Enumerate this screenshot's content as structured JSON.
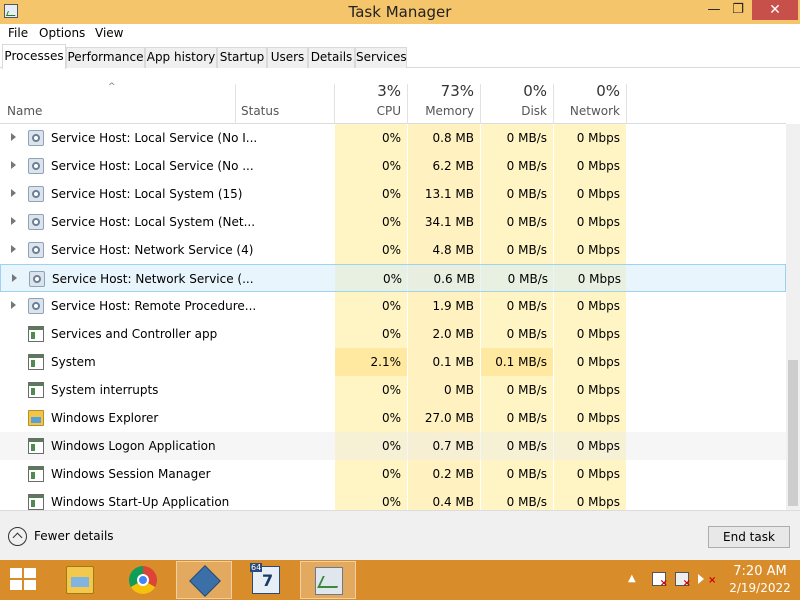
{
  "window": {
    "title": "Task Manager",
    "min_glyph": "—",
    "max_glyph": "❐",
    "close_glyph": "✕"
  },
  "menu": [
    "File",
    "Options",
    "View"
  ],
  "tabs": [
    {
      "label": "Processes",
      "active": true
    },
    {
      "label": "Performance"
    },
    {
      "label": "App history"
    },
    {
      "label": "Startup"
    },
    {
      "label": "Users"
    },
    {
      "label": "Details"
    },
    {
      "label": "Services"
    }
  ],
  "columns": {
    "name": "Name",
    "status": "Status",
    "sort_glyph": "^",
    "cpu": {
      "label": "CPU",
      "value": "3%"
    },
    "memory": {
      "label": "Memory",
      "value": "73%"
    },
    "disk": {
      "label": "Disk",
      "value": "0%"
    },
    "network": {
      "label": "Network",
      "value": "0%"
    }
  },
  "rows": [
    {
      "name": "Service Host: Local Service (No I...",
      "icon": "gear-icon",
      "expandable": true,
      "cpu": "0%",
      "memory": "0.8 MB",
      "disk": "0 MB/s",
      "network": "0 Mbps"
    },
    {
      "name": "Service Host: Local Service (No ...",
      "icon": "gear-icon",
      "expandable": true,
      "cpu": "0%",
      "memory": "6.2 MB",
      "disk": "0 MB/s",
      "network": "0 Mbps"
    },
    {
      "name": "Service Host: Local System (15)",
      "icon": "gear-icon",
      "expandable": true,
      "cpu": "0%",
      "memory": "13.1 MB",
      "disk": "0 MB/s",
      "network": "0 Mbps"
    },
    {
      "name": "Service Host: Local System (Net...",
      "icon": "gear-icon",
      "expandable": true,
      "cpu": "0%",
      "memory": "34.1 MB",
      "disk": "0 MB/s",
      "network": "0 Mbps"
    },
    {
      "name": "Service Host: Network Service (4)",
      "icon": "gear-icon",
      "expandable": true,
      "cpu": "0%",
      "memory": "4.8 MB",
      "disk": "0 MB/s",
      "network": "0 Mbps"
    },
    {
      "name": "Service Host: Network Service (...",
      "icon": "gear-icon",
      "expandable": true,
      "cpu": "0%",
      "memory": "0.6 MB",
      "disk": "0 MB/s",
      "network": "0 Mbps",
      "hovered": true
    },
    {
      "name": "Service Host: Remote Procedure...",
      "icon": "gear-icon",
      "expandable": true,
      "cpu": "0%",
      "memory": "1.9 MB",
      "disk": "0 MB/s",
      "network": "0 Mbps"
    },
    {
      "name": "Services and Controller app",
      "icon": "window-icon",
      "expandable": false,
      "cpu": "0%",
      "memory": "2.0 MB",
      "disk": "0 MB/s",
      "network": "0 Mbps"
    },
    {
      "name": "System",
      "icon": "window-icon",
      "expandable": false,
      "cpu": "2.1%",
      "memory": "0.1 MB",
      "disk": "0.1 MB/s",
      "network": "0 Mbps"
    },
    {
      "name": "System interrupts",
      "icon": "window-icon",
      "expandable": false,
      "cpu": "0%",
      "memory": "0 MB",
      "disk": "0 MB/s",
      "network": "0 Mbps"
    },
    {
      "name": "Windows Explorer",
      "icon": "folder-icon",
      "expandable": false,
      "cpu": "0%",
      "memory": "27.0 MB",
      "disk": "0 MB/s",
      "network": "0 Mbps"
    },
    {
      "name": "Windows Logon Application",
      "icon": "window-icon",
      "expandable": false,
      "cpu": "0%",
      "memory": "0.7 MB",
      "disk": "0 MB/s",
      "network": "0 Mbps",
      "selected": true
    },
    {
      "name": "Windows Session Manager",
      "icon": "window-icon",
      "expandable": false,
      "cpu": "0%",
      "memory": "0.2 MB",
      "disk": "0 MB/s",
      "network": "0 Mbps"
    },
    {
      "name": "Windows Start-Up Application",
      "icon": "window-icon",
      "expandable": false,
      "cpu": "0%",
      "memory": "0.4 MB",
      "disk": "0 MB/s",
      "network": "0 Mbps"
    }
  ],
  "footer": {
    "fewer_details": "Fewer details",
    "end_task": "End task"
  },
  "taskbar": {
    "apps": [
      {
        "name": "file-explorer-icon",
        "active": false
      },
      {
        "name": "chrome-icon",
        "active": false
      },
      {
        "name": "virtualbox-icon",
        "active": true
      },
      {
        "name": "speedtest-7-icon",
        "active": false
      },
      {
        "name": "task-manager-icon",
        "active": true
      }
    ],
    "sp7_badge": "64",
    "tray_caret": "▲",
    "time": "7:20 AM",
    "date": "2/19/2022"
  },
  "colors": {
    "titlebar": "#f5c56b",
    "taskbar": "#d98c2a",
    "heat_light": "#fff4c4",
    "hover": "#e6f3fb"
  }
}
